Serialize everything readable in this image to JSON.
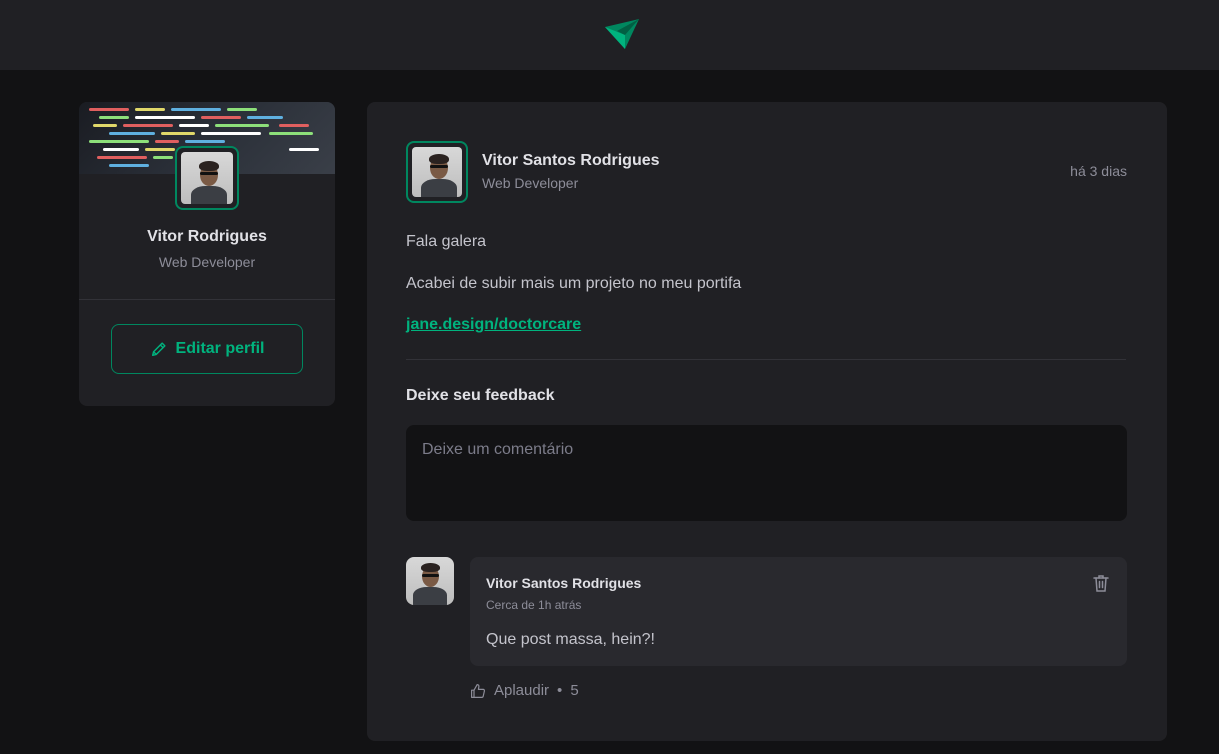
{
  "header": {
    "logo_icon": "ignite-feed-logo-icon"
  },
  "sidebar": {
    "name": "Vitor Rodrigues",
    "role": "Web Developer",
    "edit_label": "Editar perfil",
    "edit_icon": "pencil-icon"
  },
  "post": {
    "author": "Vitor Santos Rodrigues",
    "role": "Web Developer",
    "time": "há 3 dias",
    "paragraphs": [
      "Fala galera",
      "Acabei de subir mais um projeto no meu portifa"
    ],
    "link": "jane.design/doctorcare",
    "feedback_title": "Deixe seu feedback",
    "comment_placeholder": "Deixe um comentário"
  },
  "comment": {
    "author": "Vitor Santos Rodrigues",
    "time": "Cerca de 1h atrás",
    "text": "Que post massa, hein?!",
    "applaud_label": "Aplaudir",
    "applaud_separator": "•",
    "applaud_count": "5",
    "delete_icon": "trash-icon",
    "like_icon": "thumbs-up-icon"
  },
  "colors": {
    "brand": "#00875f",
    "brand_light": "#00b37e",
    "background": "#121214",
    "surface": "#202024"
  }
}
